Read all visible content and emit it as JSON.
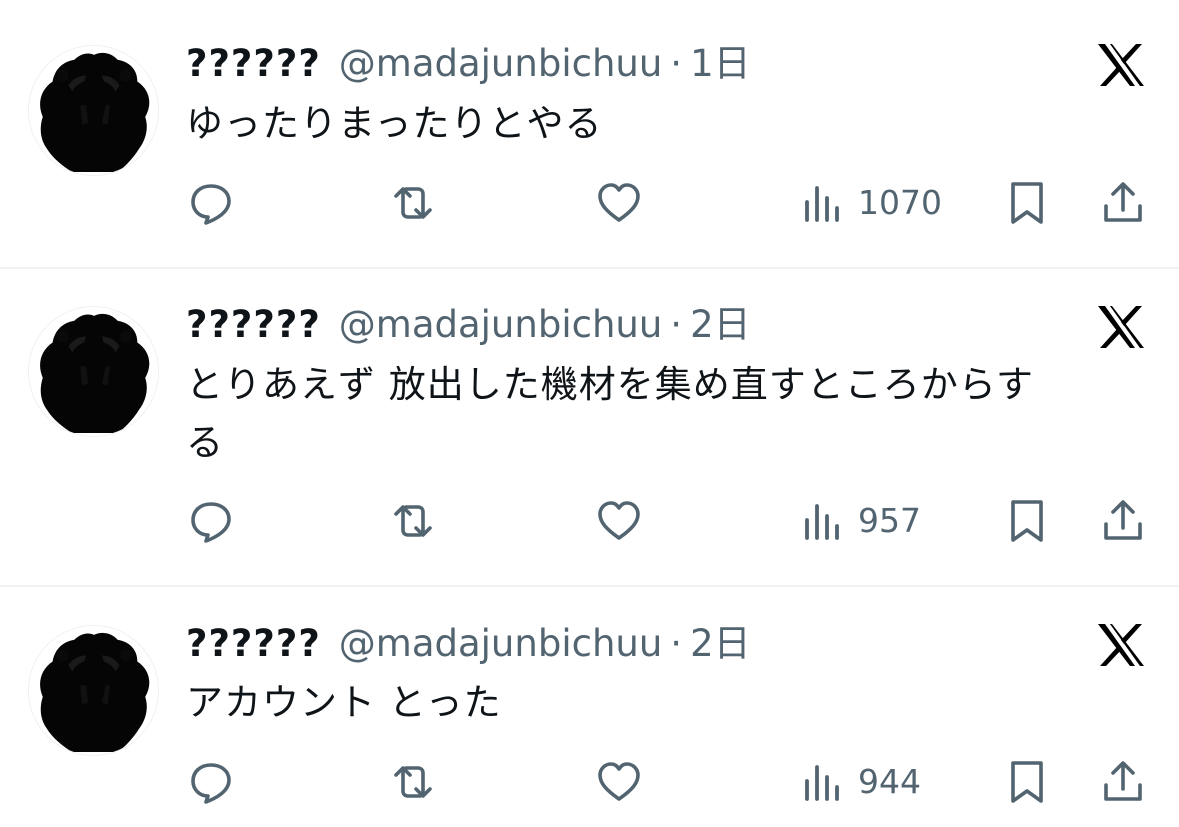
{
  "accent": "#536471",
  "tweets": [
    {
      "display_name": "??????",
      "handle": "@madajunbichuu",
      "separator": "·",
      "time": "1日",
      "text_lines": [
        "ゆったりまったりとやる"
      ],
      "views": "1070"
    },
    {
      "display_name": "??????",
      "handle": "@madajunbichuu",
      "separator": "·",
      "time": "2日",
      "text_lines": [
        "とりあえず 放出した機材を集め直すところからす",
        "る"
      ],
      "views": "957"
    },
    {
      "display_name": "??????",
      "handle": "@madajunbichuu",
      "separator": "·",
      "time": "2日",
      "text_lines": [
        "アカウント とった"
      ],
      "views": "944"
    }
  ],
  "icons": {
    "reply": "speech-bubble-icon",
    "retweet": "retweet-icon",
    "like": "heart-icon",
    "views": "bar-chart-icon",
    "bookmark": "bookmark-icon",
    "share": "share-icon",
    "brand": "x-logo-icon"
  }
}
